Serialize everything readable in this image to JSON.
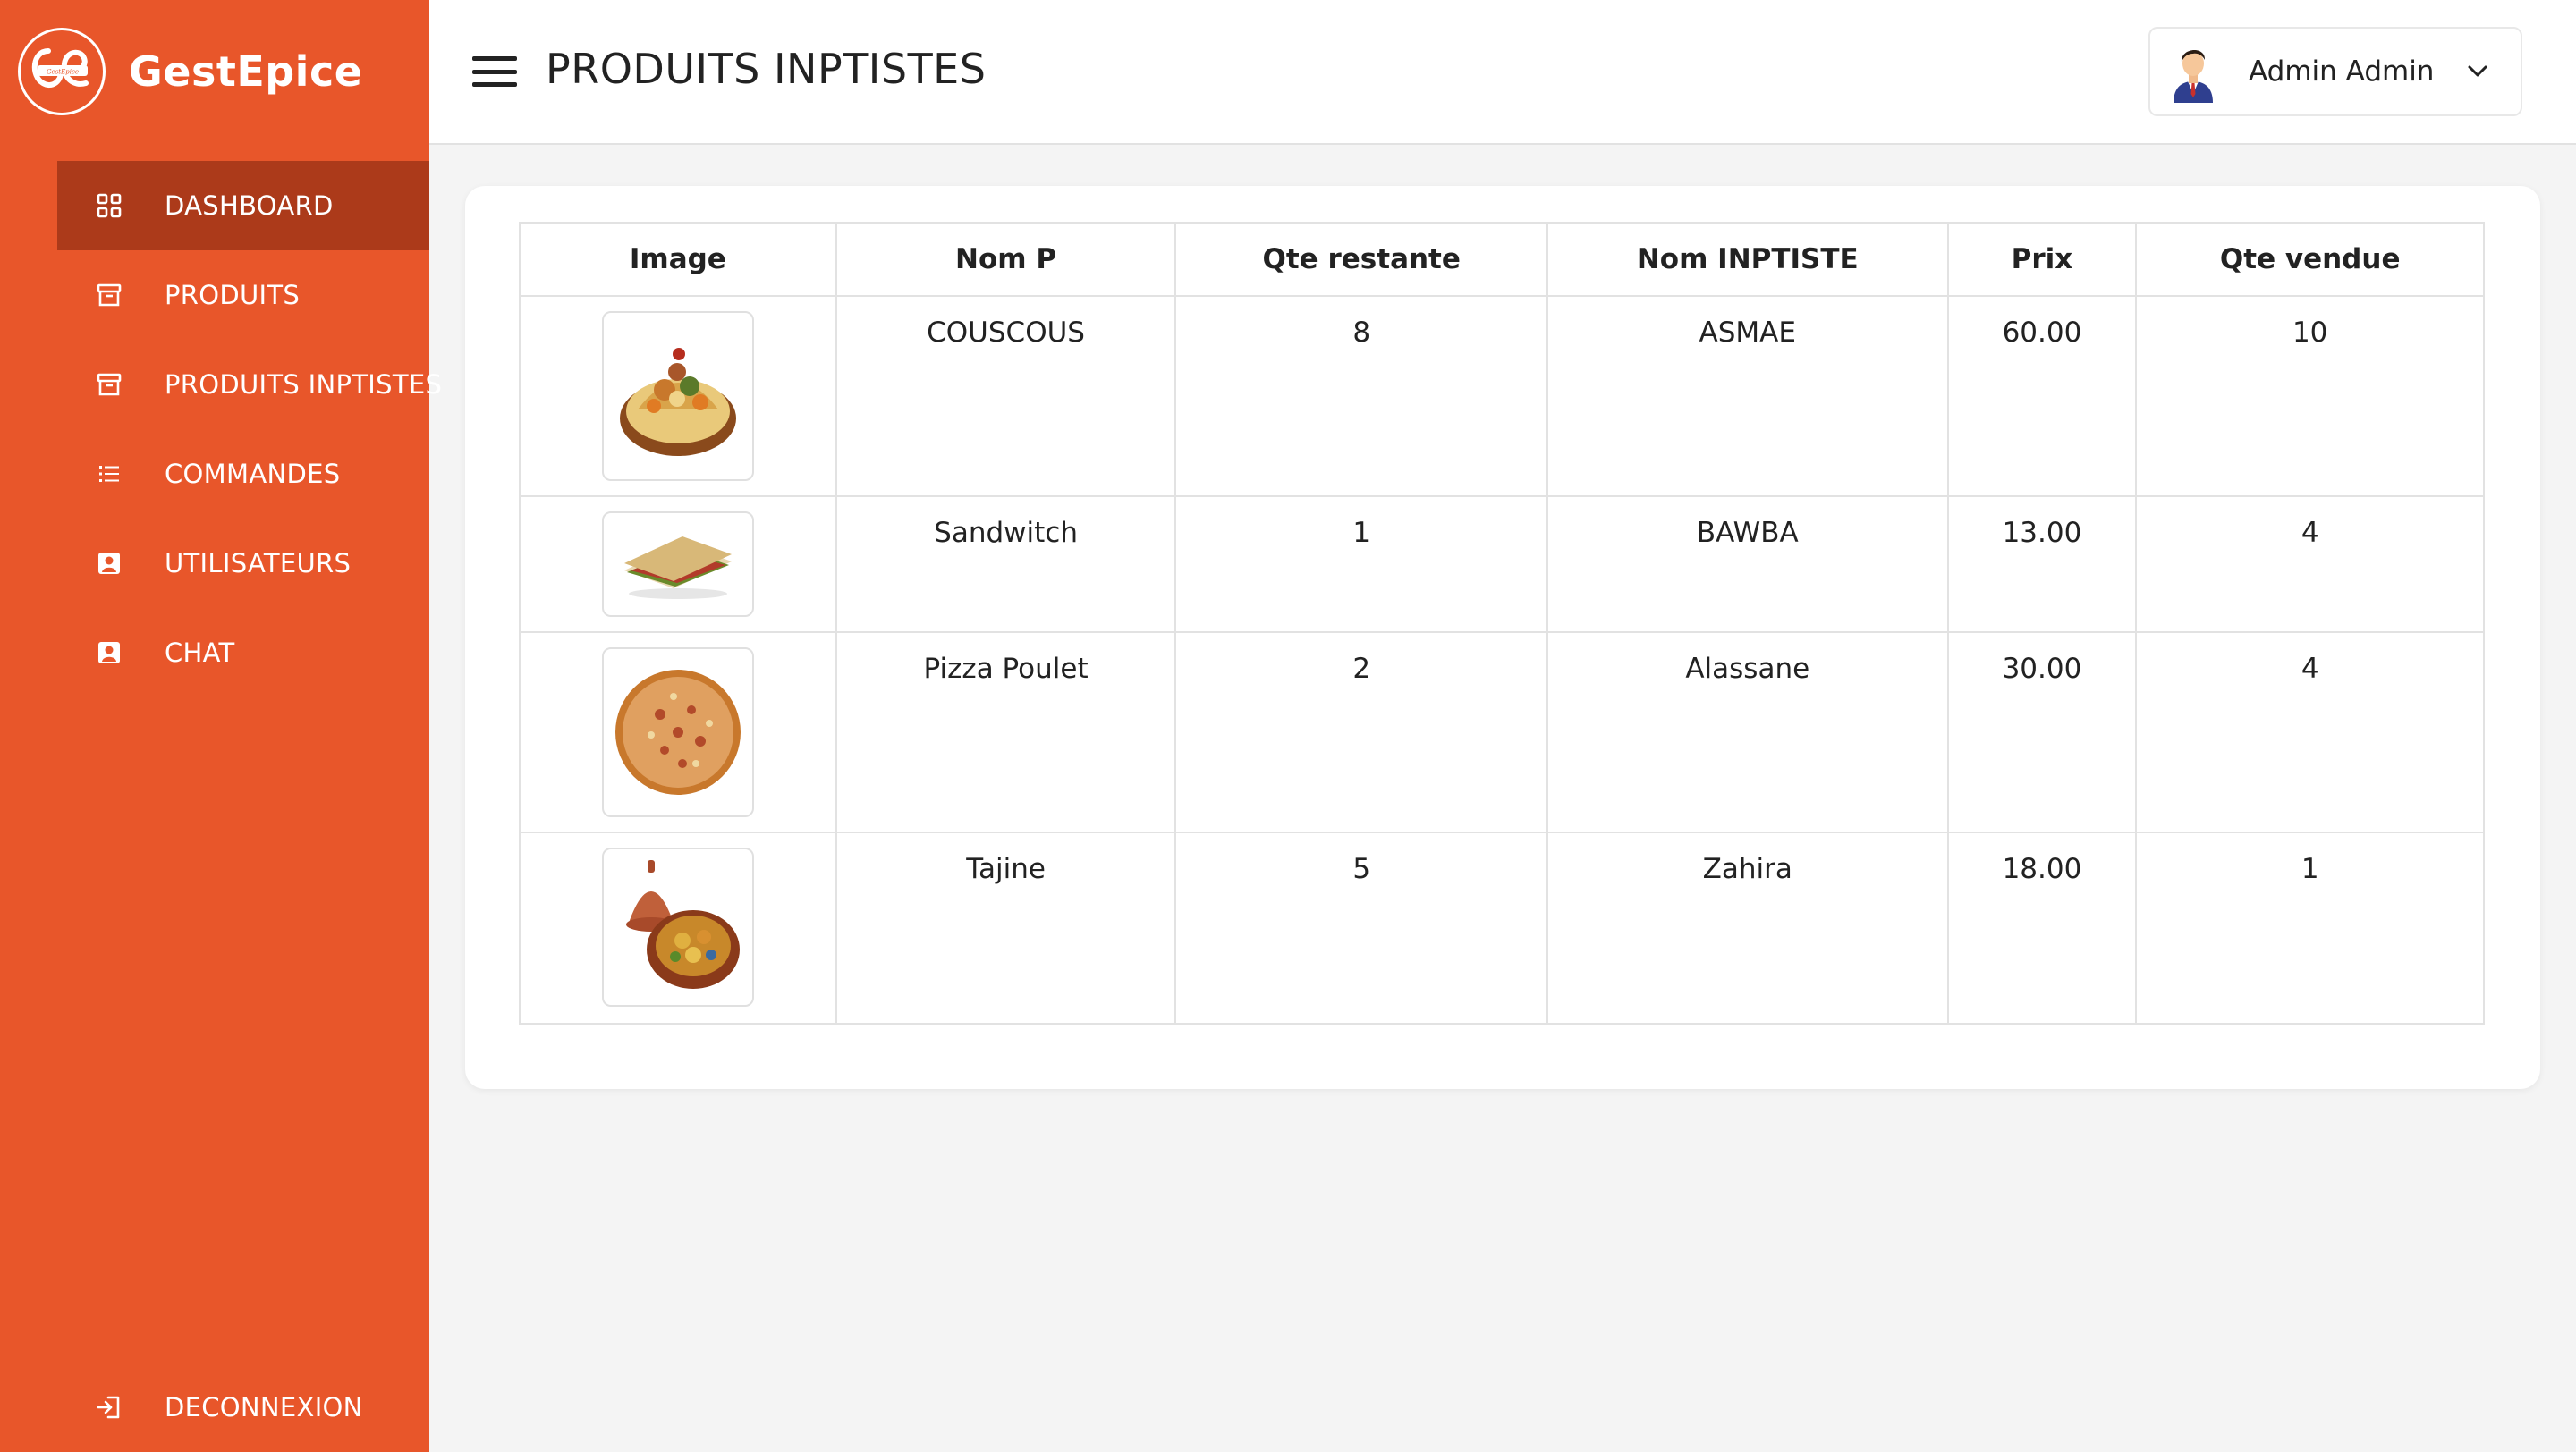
{
  "brand": {
    "name": "GestEpice",
    "logo_text": "GestEpice"
  },
  "sidebar": {
    "items": [
      {
        "label": "DASHBOARD",
        "icon": "grid-icon",
        "active": true
      },
      {
        "label": "PRODUITS",
        "icon": "archive-icon",
        "active": false
      },
      {
        "label": "PRODUITS INPTISTES",
        "icon": "archive-icon",
        "active": false
      },
      {
        "label": "COMMANDES",
        "icon": "list-icon",
        "active": false
      },
      {
        "label": "UTILISATEURS",
        "icon": "user-badge-icon",
        "active": false
      },
      {
        "label": "CHAT",
        "icon": "user-badge-icon",
        "active": false
      }
    ],
    "logout_label": "DECONNEXION"
  },
  "header": {
    "title": "PRODUITS INPTISTES",
    "user_name": "Admin Admin"
  },
  "table": {
    "columns": [
      "Image",
      "Nom P",
      "Qte restante",
      "Nom INPTISTE",
      "Prix",
      "Qte vendue"
    ],
    "rows": [
      {
        "image": "couscous-image",
        "nom": "COUSCOUS",
        "qte_restante": "8",
        "inptiste": "ASMAE",
        "prix": "60.00",
        "qte_vendue": "10"
      },
      {
        "image": "sandwich-image",
        "nom": "Sandwitch",
        "qte_restante": "1",
        "inptiste": "BAWBA",
        "prix": "13.00",
        "qte_vendue": "4"
      },
      {
        "image": "pizza-image",
        "nom": "Pizza Poulet",
        "qte_restante": "2",
        "inptiste": "Alassane",
        "prix": "30.00",
        "qte_vendue": "4"
      },
      {
        "image": "tajine-image",
        "nom": "Tajine",
        "qte_restante": "5",
        "inptiste": "Zahira",
        "prix": "18.00",
        "qte_vendue": "1"
      }
    ]
  },
  "colors": {
    "sidebar": "#e8562a",
    "sidebar_active": "#ac3a1a",
    "background": "#f4f4f4"
  }
}
